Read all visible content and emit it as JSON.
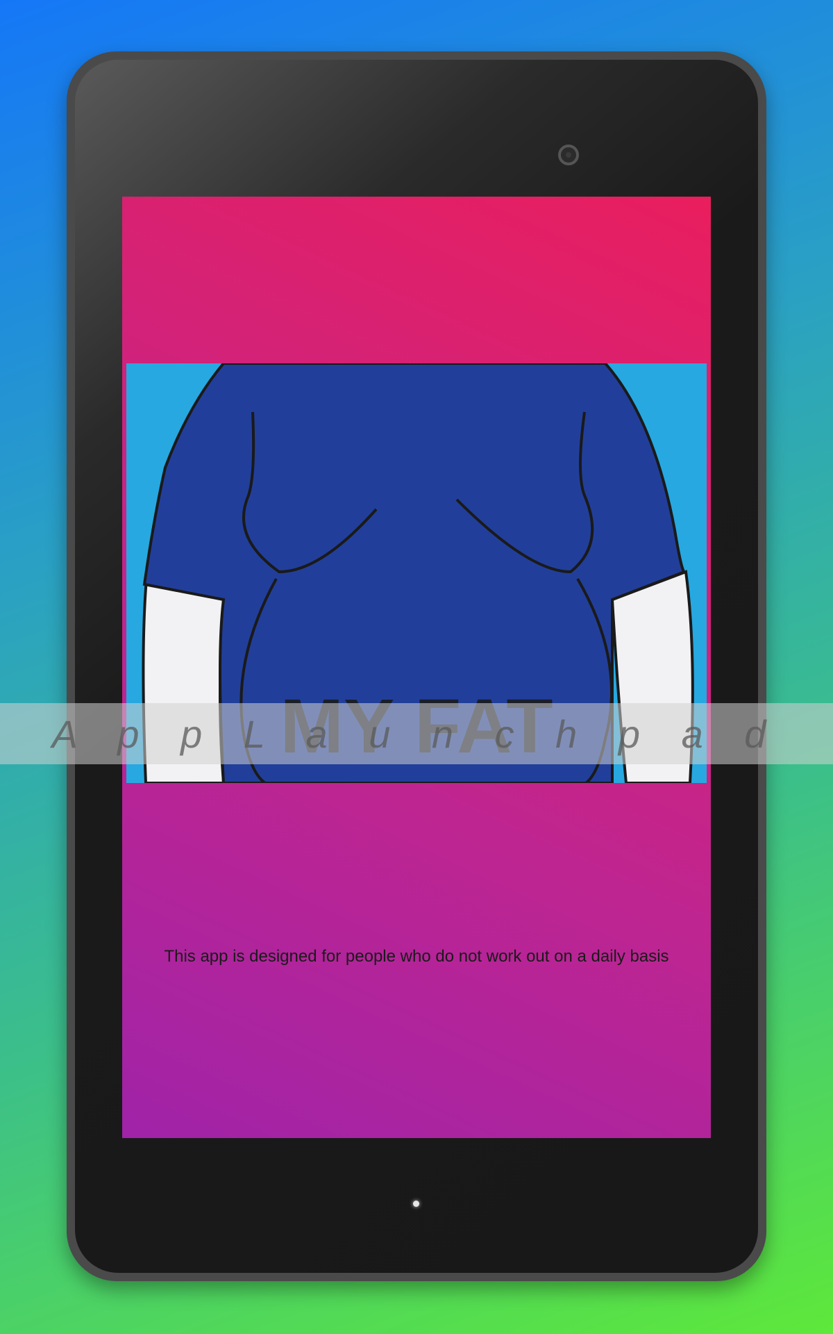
{
  "screen": {
    "description": "This app is designed for people who do not work out on a daily basis",
    "hero_image_text": "MY FAT"
  },
  "watermark": {
    "text": "A p p L a u n c h p a d"
  },
  "colors": {
    "background_top": "#1577f7",
    "background_bottom": "#5ee83a",
    "screen_top": "#e91e5e",
    "screen_bottom": "#a023a8",
    "shirt": "#213f9a",
    "hero_background": "#27a8e0"
  }
}
